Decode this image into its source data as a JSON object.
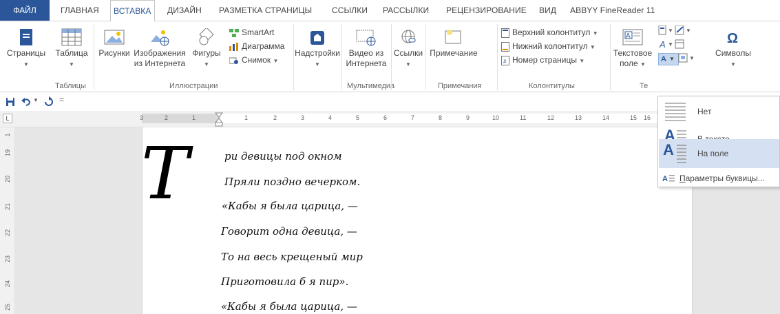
{
  "tabs": [
    {
      "label": "ФАЙЛ"
    },
    {
      "label": "ГЛАВНАЯ"
    },
    {
      "label": "ВСТАВКА"
    },
    {
      "label": "ДИЗАЙН"
    },
    {
      "label": "РАЗМЕТКА СТРАНИЦЫ"
    },
    {
      "label": "ССЫЛКИ"
    },
    {
      "label": "РАССЫЛКИ"
    },
    {
      "label": "РЕЦЕНЗИРОВАНИЕ"
    },
    {
      "label": "ВИД"
    },
    {
      "label": "ABBYY FineReader 11"
    }
  ],
  "active_tab": "ВСТАВКА",
  "ribbon": {
    "pages": {
      "label": "Страницы"
    },
    "table": {
      "label": "Таблица"
    },
    "pictures": {
      "label": "Рисунки"
    },
    "online_pictures": {
      "line1": "Изображения",
      "line2": "из Интернета"
    },
    "shapes": {
      "label": "Фигуры"
    },
    "smartart": {
      "label": "SmartArt"
    },
    "chart": {
      "label": "Диаграмма"
    },
    "screenshot": {
      "label": "Снимок"
    },
    "addins": {
      "label": "Надстройки"
    },
    "online_video": {
      "line1": "Видео из",
      "line2": "Интернета"
    },
    "links": {
      "label": "Ссылки"
    },
    "comment": {
      "label": "Примечание"
    },
    "header": {
      "label": "Верхний колонтитул"
    },
    "footer": {
      "label": "Нижний колонтитул"
    },
    "page_number": {
      "label": "Номер страницы"
    },
    "textbox": {
      "line1": "Текстовое",
      "line2": "поле"
    },
    "symbols": {
      "label": "Символы"
    },
    "groups": {
      "tables": "Таблицы",
      "illustrations": "Иллюстрации",
      "media": "Мультимедиа",
      "comments": "Примечания",
      "header_footer": "Колонтитулы",
      "text_partial": "Те"
    }
  },
  "ruler": {
    "ticks": [
      "3",
      "2",
      "1",
      "1",
      "2",
      "3",
      "4",
      "5",
      "6",
      "7",
      "8",
      "9",
      "10",
      "11",
      "12",
      "13",
      "14",
      "15",
      "16"
    ],
    "vticks": [
      "1",
      "19",
      "20",
      "21",
      "22",
      "23",
      "24",
      "25"
    ]
  },
  "document": {
    "dropcap": "Т",
    "lines": [
      "ри девицы под окном",
      "Пряли поздно вечерком.",
      "«Кабы я была царица, —",
      "Говорит одна девица, —",
      "То на весь крещеный мир",
      "Приготовила б я пир».",
      "«Кабы я была царица, —"
    ]
  },
  "dropcap_menu": {
    "items": [
      {
        "label": "Нет"
      },
      {
        "label": "В тексте"
      },
      {
        "label": "На поле"
      }
    ],
    "selected": "На поле",
    "params_underlined": "П",
    "params_rest": "араметры буквицы..."
  },
  "colors": {
    "accent": "#2b579a",
    "selection": "#d5e1f2"
  }
}
